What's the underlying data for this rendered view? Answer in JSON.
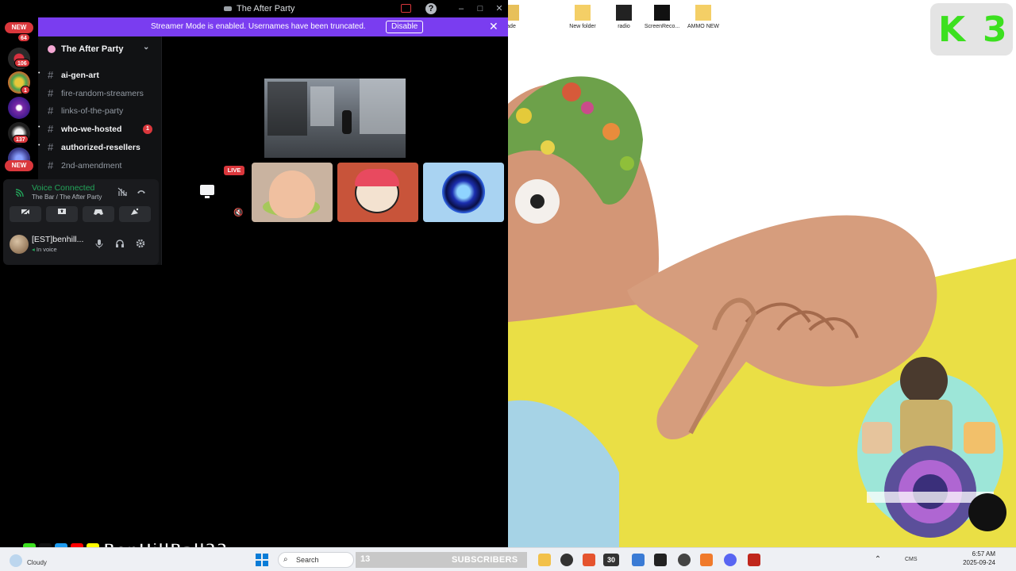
{
  "window": {
    "title": "The After Party",
    "help_icon": "?",
    "minimize": "–",
    "maximize": "□",
    "close": "✕"
  },
  "streamer_bar": {
    "message": "Streamer Mode is enabled. Usernames have been truncated.",
    "button": "Disable",
    "close": "✕"
  },
  "servers": {
    "badges": [
      "NEW",
      "NEW"
    ],
    "counts": [
      "64",
      "106",
      "1",
      "137"
    ]
  },
  "guild": {
    "name": "The After Party",
    "chevron": "⌄"
  },
  "channels": [
    {
      "name": "ai-gen-art",
      "state": "unread"
    },
    {
      "name": "fire-random-streamers",
      "state": "muted"
    },
    {
      "name": "links-of-the-party",
      "state": "muted"
    },
    {
      "name": "who-we-hosted",
      "state": "unread",
      "mentions": "1"
    },
    {
      "name": "authorized-resellers",
      "state": "unread"
    },
    {
      "name": "2nd-amendment",
      "state": "muted"
    }
  ],
  "voice": {
    "status": "Voice Connected",
    "location": "The Bar / The After Party",
    "icons": [
      "signal-icon",
      "noise-suppression-icon",
      "disconnect-icon"
    ],
    "buttons": [
      "camera-off-icon",
      "screen-share-icon",
      "activity-icon",
      "soundboard-icon"
    ]
  },
  "user": {
    "name": "[EST]benhill...",
    "status": "In voice"
  },
  "call": {
    "live_badge": "LIVE"
  },
  "desktop": {
    "icons": [
      {
        "label": "ade",
        "color": "#e7c05a"
      },
      {
        "label": "New folder",
        "color": "#f4cf66"
      },
      {
        "label": "radio",
        "color": "#222222"
      },
      {
        "label": "ScreenReco...",
        "color": "#111111"
      },
      {
        "label": "AMMO NEW",
        "color": "#f4cf66"
      }
    ],
    "logo_text": [
      "K",
      "3"
    ]
  },
  "overlay": {
    "handle": "BenHillBall22",
    "subscriber_count": "13",
    "subscriber_label": "SUBSCRIBERS"
  },
  "taskbar": {
    "weather": "Cloudy",
    "search_label": "Search",
    "badge_number": "30",
    "time": "6:57 AM",
    "date": "2025-09-24",
    "tray_label": "CMS"
  },
  "colors": {
    "brand": "#7a3df0",
    "danger": "#da373c",
    "connected": "#23a55a",
    "k3_green": "#3ce01f"
  }
}
